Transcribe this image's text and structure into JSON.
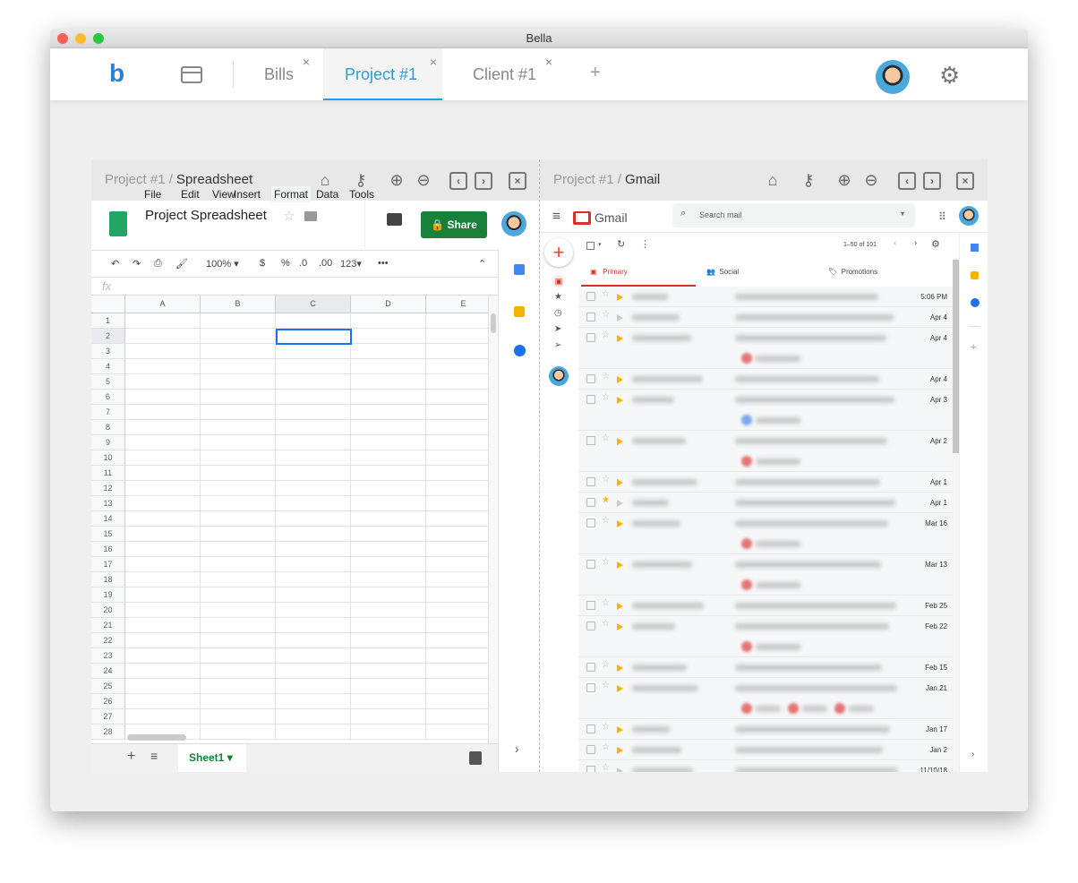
{
  "window": {
    "title": "Bella"
  },
  "appbar": {
    "tabs": [
      {
        "label": "Bills"
      },
      {
        "label": "Project #1",
        "active": true
      },
      {
        "label": "Client #1"
      }
    ],
    "close_glyph": "×",
    "add_glyph": "+"
  },
  "panes": {
    "left": {
      "crumb_parent": "Project #1 / ",
      "crumb_current": "Spreadsheet"
    },
    "right": {
      "crumb_parent": "Project #1 / ",
      "crumb_current": "Gmail"
    }
  },
  "sheets": {
    "title": "Project Spreadsheet",
    "menu": [
      "File",
      "Edit",
      "View",
      "Insert",
      "Format",
      "Data",
      "Tools"
    ],
    "share_label": "Share",
    "toolbar": {
      "zoom": "100%",
      "currency": "$",
      "percent": "%",
      "dec_less": ".0",
      "dec_more": ".00",
      "format": "123"
    },
    "fx": "fx",
    "columns": [
      "A",
      "B",
      "C",
      "D",
      "E"
    ],
    "row_count": 28,
    "selected_cell": "C2",
    "sheet_tab": "Sheet1"
  },
  "gmail": {
    "logo": "Gmail",
    "search_placeholder": "Search mail",
    "pagination": "1–50 of 101",
    "tabs": [
      "Primary",
      "Social",
      "Promotions"
    ],
    "emails": [
      {
        "date": "5:06 PM",
        "tall": false,
        "important": true
      },
      {
        "date": "Apr 4",
        "tall": false,
        "important": false
      },
      {
        "date": "Apr 4",
        "tall": true,
        "important": true,
        "chips": [
          "#e57373"
        ]
      },
      {
        "date": "Apr 4",
        "tall": false,
        "important": true
      },
      {
        "date": "Apr 3",
        "tall": true,
        "important": true,
        "chips": [
          "#7aa7f0"
        ]
      },
      {
        "date": "Apr 2",
        "tall": true,
        "important": true,
        "chips": [
          "#e57373"
        ]
      },
      {
        "date": "Apr 1",
        "tall": false,
        "important": true
      },
      {
        "date": "Apr 1",
        "tall": false,
        "important": false,
        "starred": true
      },
      {
        "date": "Mar 16",
        "tall": true,
        "important": true,
        "chips": [
          "#e57373"
        ]
      },
      {
        "date": "Mar 13",
        "tall": true,
        "important": true,
        "chips": [
          "#e57373"
        ]
      },
      {
        "date": "Feb 25",
        "tall": false,
        "important": true
      },
      {
        "date": "Feb 22",
        "tall": true,
        "important": true,
        "chips": [
          "#e57373"
        ]
      },
      {
        "date": "Feb 15",
        "tall": false,
        "important": true
      },
      {
        "date": "Jan 21",
        "tall": true,
        "important": true,
        "chips": [
          "#e57373",
          "#e57373",
          "#e57373"
        ]
      },
      {
        "date": "Jan 17",
        "tall": false,
        "important": true
      },
      {
        "date": "Jan 2",
        "tall": false,
        "important": true
      },
      {
        "date": "11/10/18",
        "tall": false,
        "important": false
      }
    ]
  },
  "colors": {
    "accent": "#2a9fd6",
    "share": "#188038",
    "gmail_red": "#d93025"
  }
}
